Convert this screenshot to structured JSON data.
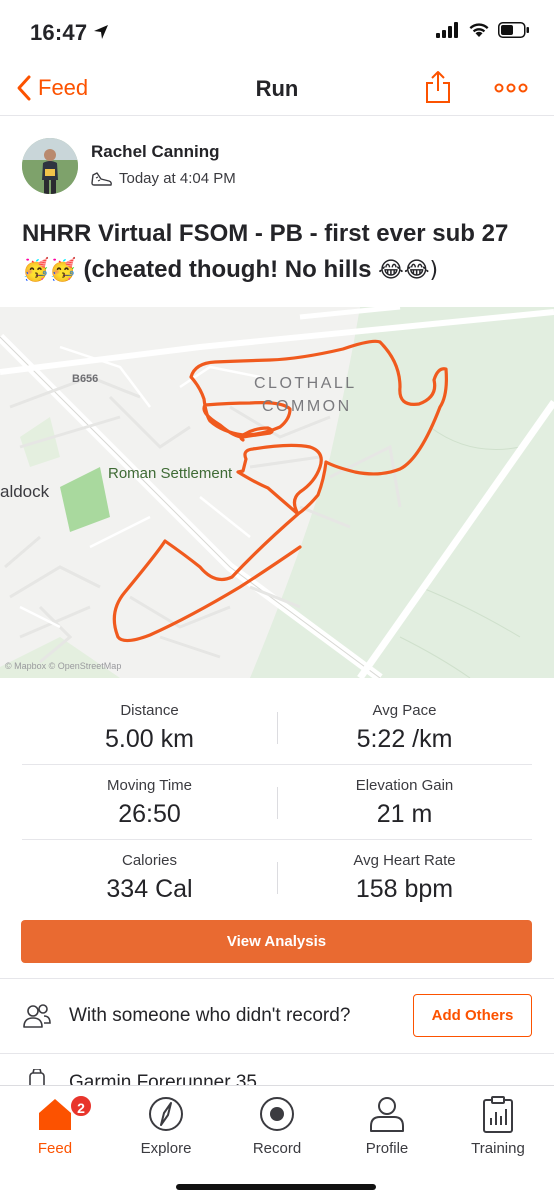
{
  "status_bar": {
    "time": "16:47"
  },
  "nav": {
    "back_label": "Feed",
    "title": "Run"
  },
  "athlete": {
    "name": "Rachel Canning",
    "timestamp": "Today at 4:04 PM"
  },
  "activity": {
    "title_line1": "NHRR Virtual FSOM - PB - first ever sub 27",
    "title_line2_emoji": "🥳🥳",
    "title_line2": "(cheated though! No hills",
    "title_line2_end_emoji": "😂😂)"
  },
  "map": {
    "labels": {
      "road": "B656",
      "area_line1": "CLOTHALL",
      "area_line2": "COMMON",
      "settlement": "Roman Settlement",
      "town": "aldock",
      "attribution": "© Mapbox © OpenStreetMap"
    },
    "route_color": "#f05a1e"
  },
  "stats": {
    "distance_label": "Distance",
    "distance_value": "5.00 km",
    "pace_label": "Avg Pace",
    "pace_value": "5:22 /km",
    "time_label": "Moving Time",
    "time_value": "26:50",
    "elevation_label": "Elevation Gain",
    "elevation_value": "21 m",
    "calories_label": "Calories",
    "calories_value": "334 Cal",
    "hr_label": "Avg Heart Rate",
    "hr_value": "158 bpm"
  },
  "buttons": {
    "analysis": "View Analysis",
    "add_others": "Add Others"
  },
  "with_row": {
    "text": "With someone who didn't record?"
  },
  "device": {
    "name": "Garmin Forerunner 35"
  },
  "tabbar": {
    "feed": "Feed",
    "feed_badge": "2",
    "explore": "Explore",
    "record": "Record",
    "profile": "Profile",
    "training": "Training"
  },
  "colors": {
    "accent": "#fc5200",
    "button": "#e96a31",
    "badge": "#e8352c"
  }
}
